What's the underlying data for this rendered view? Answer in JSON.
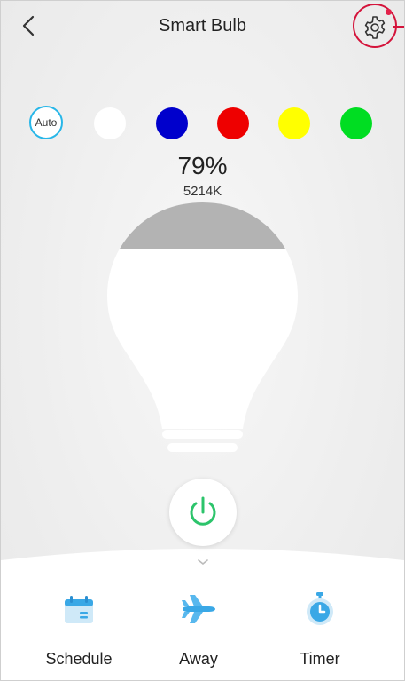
{
  "header": {
    "title": "Smart Bulb"
  },
  "colors": {
    "auto_label": "Auto",
    "swatches": [
      {
        "name": "white",
        "hex": "#ffffff"
      },
      {
        "name": "blue",
        "hex": "#0000cc"
      },
      {
        "name": "red",
        "hex": "#ee0000"
      },
      {
        "name": "yellow",
        "hex": "#ffff00"
      },
      {
        "name": "green",
        "hex": "#00dd22"
      }
    ],
    "accent": "#27b6e8",
    "highlight": "#d4143b"
  },
  "status": {
    "brightness": "79%",
    "color_temperature": "5214K"
  },
  "actions": [
    {
      "label": "Schedule",
      "icon": "calendar-icon"
    },
    {
      "label": "Away",
      "icon": "airplane-icon"
    },
    {
      "label": "Timer",
      "icon": "stopwatch-icon"
    }
  ]
}
